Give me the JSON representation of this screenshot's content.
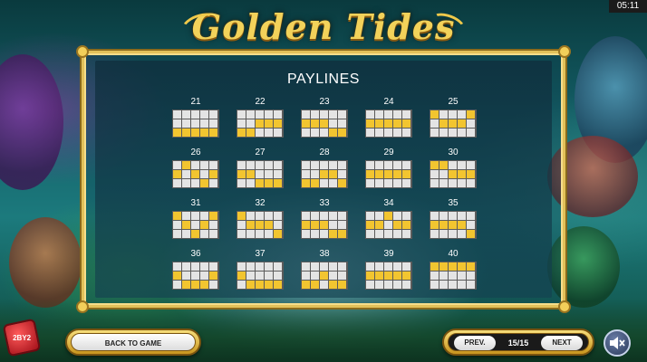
{
  "clock": "05:11",
  "logo": {
    "text": "Golden Tides"
  },
  "panel": {
    "title": "PAYLINES"
  },
  "paylines": [
    {
      "number": "21",
      "pattern": [
        [
          0,
          0,
          0,
          0,
          0
        ],
        [
          0,
          0,
          0,
          0,
          0
        ],
        [
          1,
          1,
          1,
          1,
          1
        ]
      ]
    },
    {
      "number": "22",
      "pattern": [
        [
          0,
          0,
          0,
          0,
          0
        ],
        [
          0,
          0,
          1,
          1,
          1
        ],
        [
          1,
          1,
          0,
          0,
          0
        ]
      ]
    },
    {
      "number": "23",
      "pattern": [
        [
          0,
          0,
          0,
          0,
          0
        ],
        [
          1,
          1,
          1,
          0,
          0
        ],
        [
          0,
          0,
          0,
          1,
          1
        ]
      ]
    },
    {
      "number": "24",
      "pattern": [
        [
          0,
          0,
          0,
          0,
          0
        ],
        [
          1,
          1,
          1,
          1,
          1
        ],
        [
          0,
          0,
          0,
          0,
          0
        ]
      ]
    },
    {
      "number": "25",
      "pattern": [
        [
          1,
          0,
          0,
          0,
          1
        ],
        [
          0,
          1,
          1,
          1,
          0
        ],
        [
          0,
          0,
          0,
          0,
          0
        ]
      ]
    },
    {
      "number": "26",
      "pattern": [
        [
          0,
          1,
          0,
          0,
          0
        ],
        [
          1,
          0,
          1,
          0,
          1
        ],
        [
          0,
          0,
          0,
          1,
          0
        ]
      ]
    },
    {
      "number": "27",
      "pattern": [
        [
          0,
          0,
          0,
          0,
          0
        ],
        [
          1,
          1,
          0,
          0,
          0
        ],
        [
          0,
          0,
          1,
          1,
          1
        ]
      ]
    },
    {
      "number": "28",
      "pattern": [
        [
          0,
          0,
          0,
          0,
          0
        ],
        [
          0,
          0,
          1,
          1,
          0
        ],
        [
          1,
          1,
          0,
          0,
          1
        ]
      ]
    },
    {
      "number": "29",
      "pattern": [
        [
          0,
          0,
          0,
          0,
          0
        ],
        [
          1,
          1,
          1,
          1,
          1
        ],
        [
          0,
          0,
          0,
          0,
          0
        ]
      ]
    },
    {
      "number": "30",
      "pattern": [
        [
          1,
          1,
          0,
          0,
          0
        ],
        [
          0,
          0,
          1,
          1,
          1
        ],
        [
          0,
          0,
          0,
          0,
          0
        ]
      ]
    },
    {
      "number": "31",
      "pattern": [
        [
          1,
          0,
          0,
          0,
          1
        ],
        [
          0,
          1,
          0,
          1,
          0
        ],
        [
          0,
          0,
          1,
          0,
          0
        ]
      ]
    },
    {
      "number": "32",
      "pattern": [
        [
          1,
          0,
          0,
          0,
          0
        ],
        [
          0,
          1,
          1,
          1,
          0
        ],
        [
          0,
          0,
          0,
          0,
          1
        ]
      ]
    },
    {
      "number": "33",
      "pattern": [
        [
          0,
          0,
          0,
          0,
          0
        ],
        [
          1,
          1,
          1,
          0,
          0
        ],
        [
          0,
          0,
          0,
          1,
          1
        ]
      ]
    },
    {
      "number": "34",
      "pattern": [
        [
          0,
          0,
          1,
          0,
          0
        ],
        [
          1,
          1,
          0,
          1,
          1
        ],
        [
          0,
          0,
          0,
          0,
          0
        ]
      ]
    },
    {
      "number": "35",
      "pattern": [
        [
          0,
          0,
          0,
          0,
          0
        ],
        [
          1,
          1,
          1,
          1,
          0
        ],
        [
          0,
          0,
          0,
          0,
          1
        ]
      ]
    },
    {
      "number": "36",
      "pattern": [
        [
          0,
          0,
          0,
          0,
          0
        ],
        [
          1,
          0,
          0,
          0,
          1
        ],
        [
          0,
          1,
          1,
          1,
          0
        ]
      ]
    },
    {
      "number": "37",
      "pattern": [
        [
          0,
          0,
          0,
          0,
          0
        ],
        [
          1,
          0,
          0,
          0,
          0
        ],
        [
          0,
          1,
          1,
          1,
          1
        ]
      ]
    },
    {
      "number": "38",
      "pattern": [
        [
          0,
          0,
          0,
          0,
          0
        ],
        [
          0,
          0,
          1,
          0,
          0
        ],
        [
          1,
          1,
          0,
          1,
          1
        ]
      ]
    },
    {
      "number": "39",
      "pattern": [
        [
          0,
          0,
          0,
          0,
          0
        ],
        [
          1,
          1,
          1,
          1,
          1
        ],
        [
          0,
          0,
          0,
          0,
          0
        ]
      ]
    },
    {
      "number": "40",
      "pattern": [
        [
          1,
          1,
          1,
          1,
          1
        ],
        [
          0,
          0,
          0,
          0,
          0
        ],
        [
          0,
          0,
          0,
          0,
          0
        ]
      ]
    }
  ],
  "controls": {
    "back_label": "BACK TO GAME",
    "prev_label": "PREV.",
    "page_indicator": "15/15",
    "next_label": "NEXT"
  },
  "brand": {
    "text": "2BY2"
  },
  "icons": {
    "sound": "speaker-muted-icon"
  },
  "colors": {
    "active_cell": "#f2c530",
    "inactive_cell": "#e4e4e4",
    "frame_gold": "#e2c15a"
  }
}
